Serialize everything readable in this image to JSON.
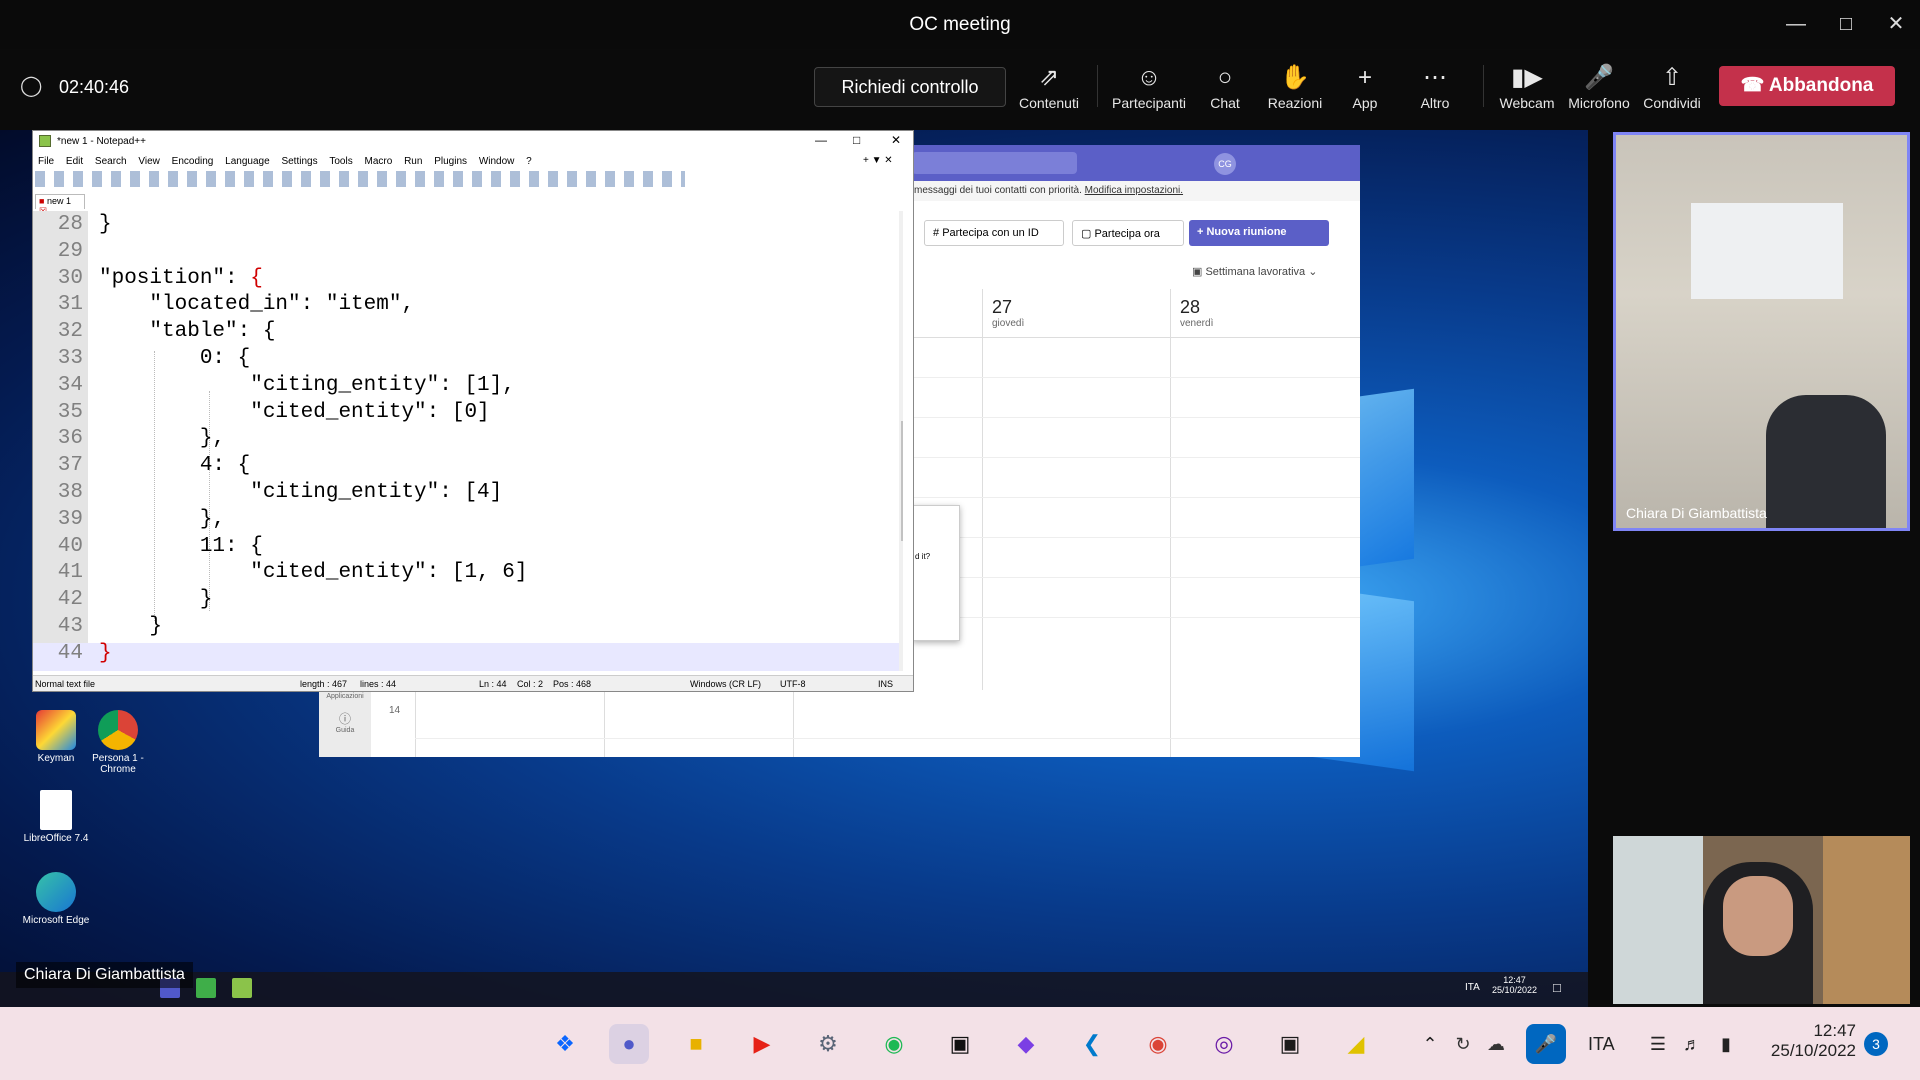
{
  "window": {
    "title": "OC meeting"
  },
  "call": {
    "timer": "02:40:46",
    "request_control_label": "Richiedi controllo",
    "toolbar": [
      {
        "label": "Contenuti",
        "icon": "share-content-icon"
      },
      {
        "label": "Partecipanti",
        "icon": "people-icon"
      },
      {
        "label": "Chat",
        "icon": "chat-icon"
      },
      {
        "label": "Reazioni",
        "icon": "raise-hand-icon"
      },
      {
        "label": "App",
        "icon": "plus-icon"
      },
      {
        "label": "Altro",
        "icon": "more-icon"
      },
      {
        "label": "Webcam",
        "icon": "camera-icon"
      },
      {
        "label": "Microfono",
        "icon": "microphone-icon"
      },
      {
        "label": "Condividi",
        "icon": "share-screen-icon"
      }
    ],
    "leave_label": "Abbandona",
    "presenter_name": "Chiara Di Giambattista",
    "remote_presenter_name": "Chiara Di Giambattista"
  },
  "notepad": {
    "title": "*new 1 - Notepad++",
    "menu": [
      "File",
      "Edit",
      "Search",
      "View",
      "Encoding",
      "Language",
      "Settings",
      "Tools",
      "Macro",
      "Run",
      "Plugins",
      "Window",
      "?"
    ],
    "tab": "new 1",
    "lines": [
      {
        "n": "28",
        "text": "}"
      },
      {
        "n": "29",
        "text": ""
      },
      {
        "n": "30",
        "text": "\"position\": {"
      },
      {
        "n": "31",
        "text": "    \"located_in\": \"item\","
      },
      {
        "n": "32",
        "text": "    \"table\": {"
      },
      {
        "n": "33",
        "text": "        0: {"
      },
      {
        "n": "34",
        "text": "            \"citing_entity\": [1],"
      },
      {
        "n": "35",
        "text": "            \"cited_entity\": [0]"
      },
      {
        "n": "36",
        "text": "        },"
      },
      {
        "n": "37",
        "text": "        4: {"
      },
      {
        "n": "38",
        "text": "            \"citing_entity\": [4]"
      },
      {
        "n": "39",
        "text": "        },"
      },
      {
        "n": "40",
        "text": "        11: {"
      },
      {
        "n": "41",
        "text": "            \"cited_entity\": [1, 6]"
      },
      {
        "n": "42",
        "text": "        }"
      },
      {
        "n": "43",
        "text": "    }"
      },
      {
        "n": "44",
        "text": "}"
      }
    ],
    "status": {
      "type": "Normal text file",
      "length": "length : 467",
      "lines": "lines : 44",
      "ln": "Ln : 44",
      "col": "Col : 2",
      "pos": "Pos : 468",
      "eol": "Windows (CR LF)",
      "encoding": "UTF-8",
      "mode": "INS"
    }
  },
  "teams_bg": {
    "banner": "messaggi dei tuoi contatti con priorità.",
    "banner_link": "Modifica impostazioni.",
    "join_id": "Partecipa con un ID",
    "join_now": "Partecipa ora",
    "new_meeting": "Nuova riunione",
    "week_view": "Settimana lavorativa",
    "days": [
      {
        "num": "27",
        "name": "giovedì"
      },
      {
        "num": "28",
        "name": "venerdì"
      }
    ],
    "hour": "14",
    "apps_label": "Applicazioni",
    "help_label": "Guida",
    "dialog_text": "d it?"
  },
  "desktop_icons": [
    {
      "label": "Keyman"
    },
    {
      "label": "Persona 1 - Chrome"
    },
    {
      "label": "LibreOffice 7.4"
    },
    {
      "label": "Microsoft Edge"
    }
  ],
  "remote_tray": {
    "lang": "ITA",
    "time": "12:47",
    "date": "25/10/2022"
  },
  "local_tray": {
    "lang": "ITA",
    "time": "12:47",
    "date": "25/10/2022",
    "notif_count": "3"
  }
}
